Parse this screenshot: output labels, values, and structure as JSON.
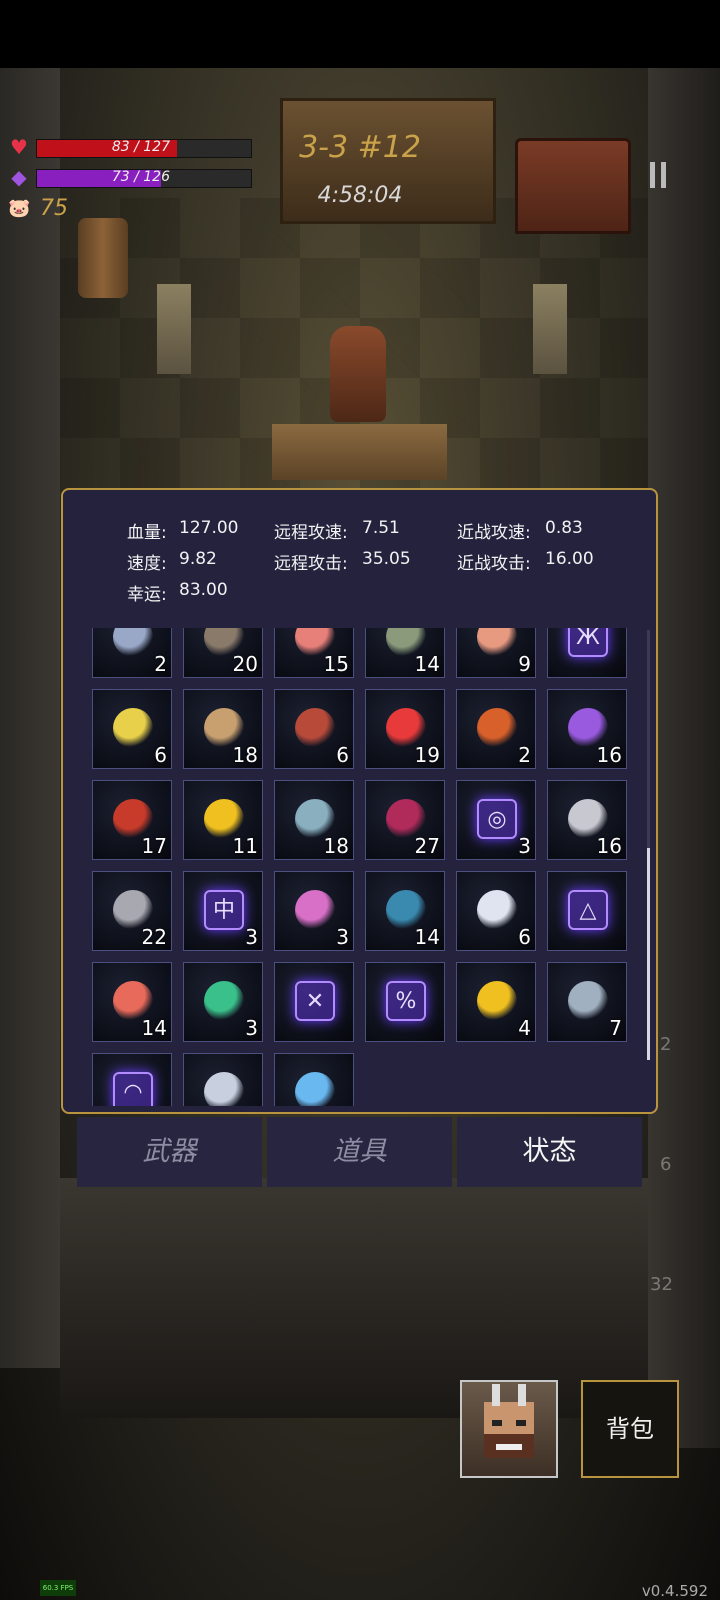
{
  "hud": {
    "hp_text": "83 / 127",
    "hp": 83,
    "hp_max": 127,
    "mp_text": "73 / 126",
    "mp": 73,
    "mp_max": 126,
    "coins": "75",
    "stage": "3-3 #12",
    "timer": "4:58:04"
  },
  "stats": [
    {
      "label": "血量:",
      "value": "127.00"
    },
    {
      "label": "远程攻速:",
      "value": "7.51"
    },
    {
      "label": "近战攻速:",
      "value": "0.83"
    },
    {
      "label": "速度:",
      "value": "9.82"
    },
    {
      "label": "远程攻击:",
      "value": "35.05"
    },
    {
      "label": "近战攻击:",
      "value": "16.00"
    },
    {
      "label": "幸运:",
      "value": "83.00"
    }
  ],
  "items": [
    {
      "icon": "shield-cross-icon",
      "count": "2"
    },
    {
      "icon": "boots-icon",
      "count": "20"
    },
    {
      "icon": "pink-crystal-icon",
      "count": "15"
    },
    {
      "icon": "octopus-icon",
      "count": "14"
    },
    {
      "icon": "pink-stone-icon",
      "count": "9"
    },
    {
      "icon": "purple-rune-icon",
      "count": ""
    },
    {
      "icon": "star-cluster-icon",
      "count": "6"
    },
    {
      "icon": "horseshoe-icon",
      "count": "18"
    },
    {
      "icon": "gloves-icon",
      "count": "6"
    },
    {
      "icon": "red-crystal-icon",
      "count": "19"
    },
    {
      "icon": "spellbook-icon",
      "count": "2"
    },
    {
      "icon": "wand-icon",
      "count": "16"
    },
    {
      "icon": "fire-potion-icon",
      "count": "17"
    },
    {
      "icon": "gold-coin-icon",
      "count": "11"
    },
    {
      "icon": "blue-stone-icon",
      "count": "18"
    },
    {
      "icon": "red-book-icon",
      "count": "27"
    },
    {
      "icon": "spiral-rune-icon",
      "count": "3"
    },
    {
      "icon": "silver-ore-icon",
      "count": "16"
    },
    {
      "icon": "cloak-icon",
      "count": "22"
    },
    {
      "icon": "chinese-rune-icon",
      "count": "3"
    },
    {
      "icon": "pink-slime-icon",
      "count": "3"
    },
    {
      "icon": "blue-book-icon",
      "count": "14"
    },
    {
      "icon": "diamond-sigil-icon",
      "count": "6"
    },
    {
      "icon": "triangle-rune-icon",
      "count": ""
    },
    {
      "icon": "fish-icon",
      "count": "14"
    },
    {
      "icon": "rainbow-orb-icon",
      "count": "3"
    },
    {
      "icon": "cross-rune-icon",
      "count": ""
    },
    {
      "icon": "percent-rune-icon",
      "count": ""
    },
    {
      "icon": "star-trophy-icon",
      "count": "4"
    },
    {
      "icon": "hammer-icon",
      "count": "7"
    },
    {
      "icon": "gauge-rune-icon",
      "count": ""
    },
    {
      "icon": "crystal-shape-icon",
      "count": ""
    },
    {
      "icon": "blue-orb-icon",
      "count": ""
    }
  ],
  "tabs": {
    "weapons": "武器",
    "props": "道具",
    "status": "状态"
  },
  "bag_label": "背包",
  "side_numbers": [
    "2",
    "6",
    "32"
  ],
  "fps": "60.3 FPS",
  "version": "v0.4.592"
}
